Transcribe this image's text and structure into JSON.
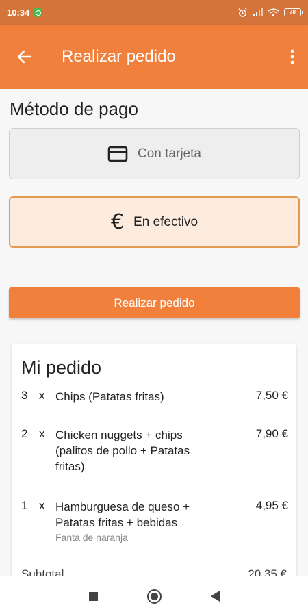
{
  "status_bar": {
    "time": "10:34",
    "battery": "78"
  },
  "app_bar": {
    "title": "Realizar pedido"
  },
  "payment": {
    "heading": "Método de pago",
    "options": [
      {
        "label": "Con tarjeta",
        "icon": "credit-card-icon",
        "selected": false
      },
      {
        "label": "En efectivo",
        "icon": "euro-icon",
        "symbol": "€",
        "selected": true
      }
    ]
  },
  "place_order_button": "Realizar pedido",
  "order": {
    "title": "Mi pedido",
    "items": [
      {
        "qty": "3",
        "sep": "x",
        "name": "Chips (Patatas fritas)",
        "note": "",
        "price": "7,50 €"
      },
      {
        "qty": "2",
        "sep": "x",
        "name": "Chicken nuggets + chips (palitos de pollo + Patatas fritas)",
        "note": "",
        "price": "7,90 €"
      },
      {
        "qty": "1",
        "sep": "x",
        "name": "Hamburguesa de queso + Patatas fritas + bebidas",
        "note": "Fanta de naranja",
        "price": "4,95 €"
      }
    ],
    "subtotal_label": "Subtotal",
    "subtotal_value": "20,35 €"
  },
  "colors": {
    "primary": "#f0803c",
    "status_bar": "#d4733a",
    "selected_bg": "#fdebdd",
    "selected_border": "#e29a50"
  }
}
